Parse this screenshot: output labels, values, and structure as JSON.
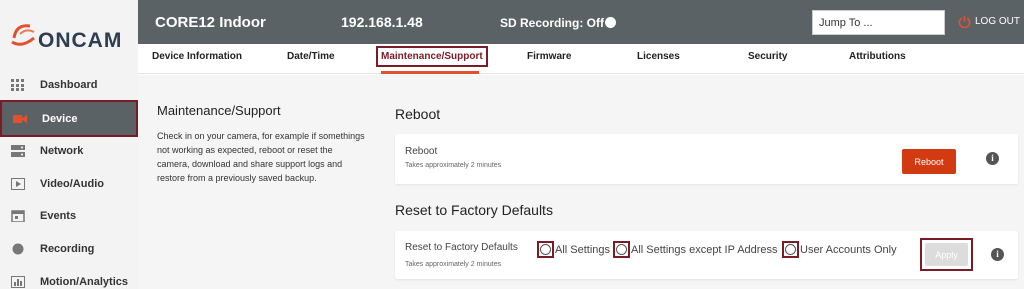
{
  "brand": {
    "logo_text": "ONCAM",
    "accent": "#e2502f",
    "selection": "#7a1c25"
  },
  "header": {
    "device_name": "CORE12 Indoor",
    "ip": "192.168.1.48",
    "sd_recording": "SD Recording: Off",
    "jump_placeholder": "Jump To ...",
    "logout": "LOG OUT"
  },
  "sidebar": {
    "items": [
      {
        "label": "Dashboard",
        "icon": "grid-icon"
      },
      {
        "label": "Device",
        "icon": "camera-icon",
        "active": true
      },
      {
        "label": "Network",
        "icon": "server-icon"
      },
      {
        "label": "Video/Audio",
        "icon": "play-icon"
      },
      {
        "label": "Events",
        "icon": "calendar-icon"
      },
      {
        "label": "Recording",
        "icon": "record-icon"
      },
      {
        "label": "Motion/Analytics",
        "icon": "chart-icon"
      }
    ]
  },
  "tabs": [
    {
      "label": "Device Information"
    },
    {
      "label": "Date/Time"
    },
    {
      "label": "Maintenance/Support",
      "active": true
    },
    {
      "label": "Firmware"
    },
    {
      "label": "Licenses"
    },
    {
      "label": "Security"
    },
    {
      "label": "Attributions"
    }
  ],
  "info": {
    "title": "Maintenance/Support",
    "description": "Check in on your camera, for example if somethings not working as expected, reboot or reset the camera, download and share support logs and restore from a previously saved backup."
  },
  "reboot": {
    "section_title": "Reboot",
    "card_title": "Reboot",
    "card_sub": "Takes approximately 2 minutes",
    "button": "Reboot"
  },
  "factory": {
    "section_title": "Reset to Factory Defaults",
    "card_title": "Reset to Factory Defaults",
    "card_sub": "Takes approximately 2 minutes",
    "options": [
      "All Settings",
      "All Settings except IP Address",
      "User Accounts Only"
    ],
    "button": "Apply"
  }
}
